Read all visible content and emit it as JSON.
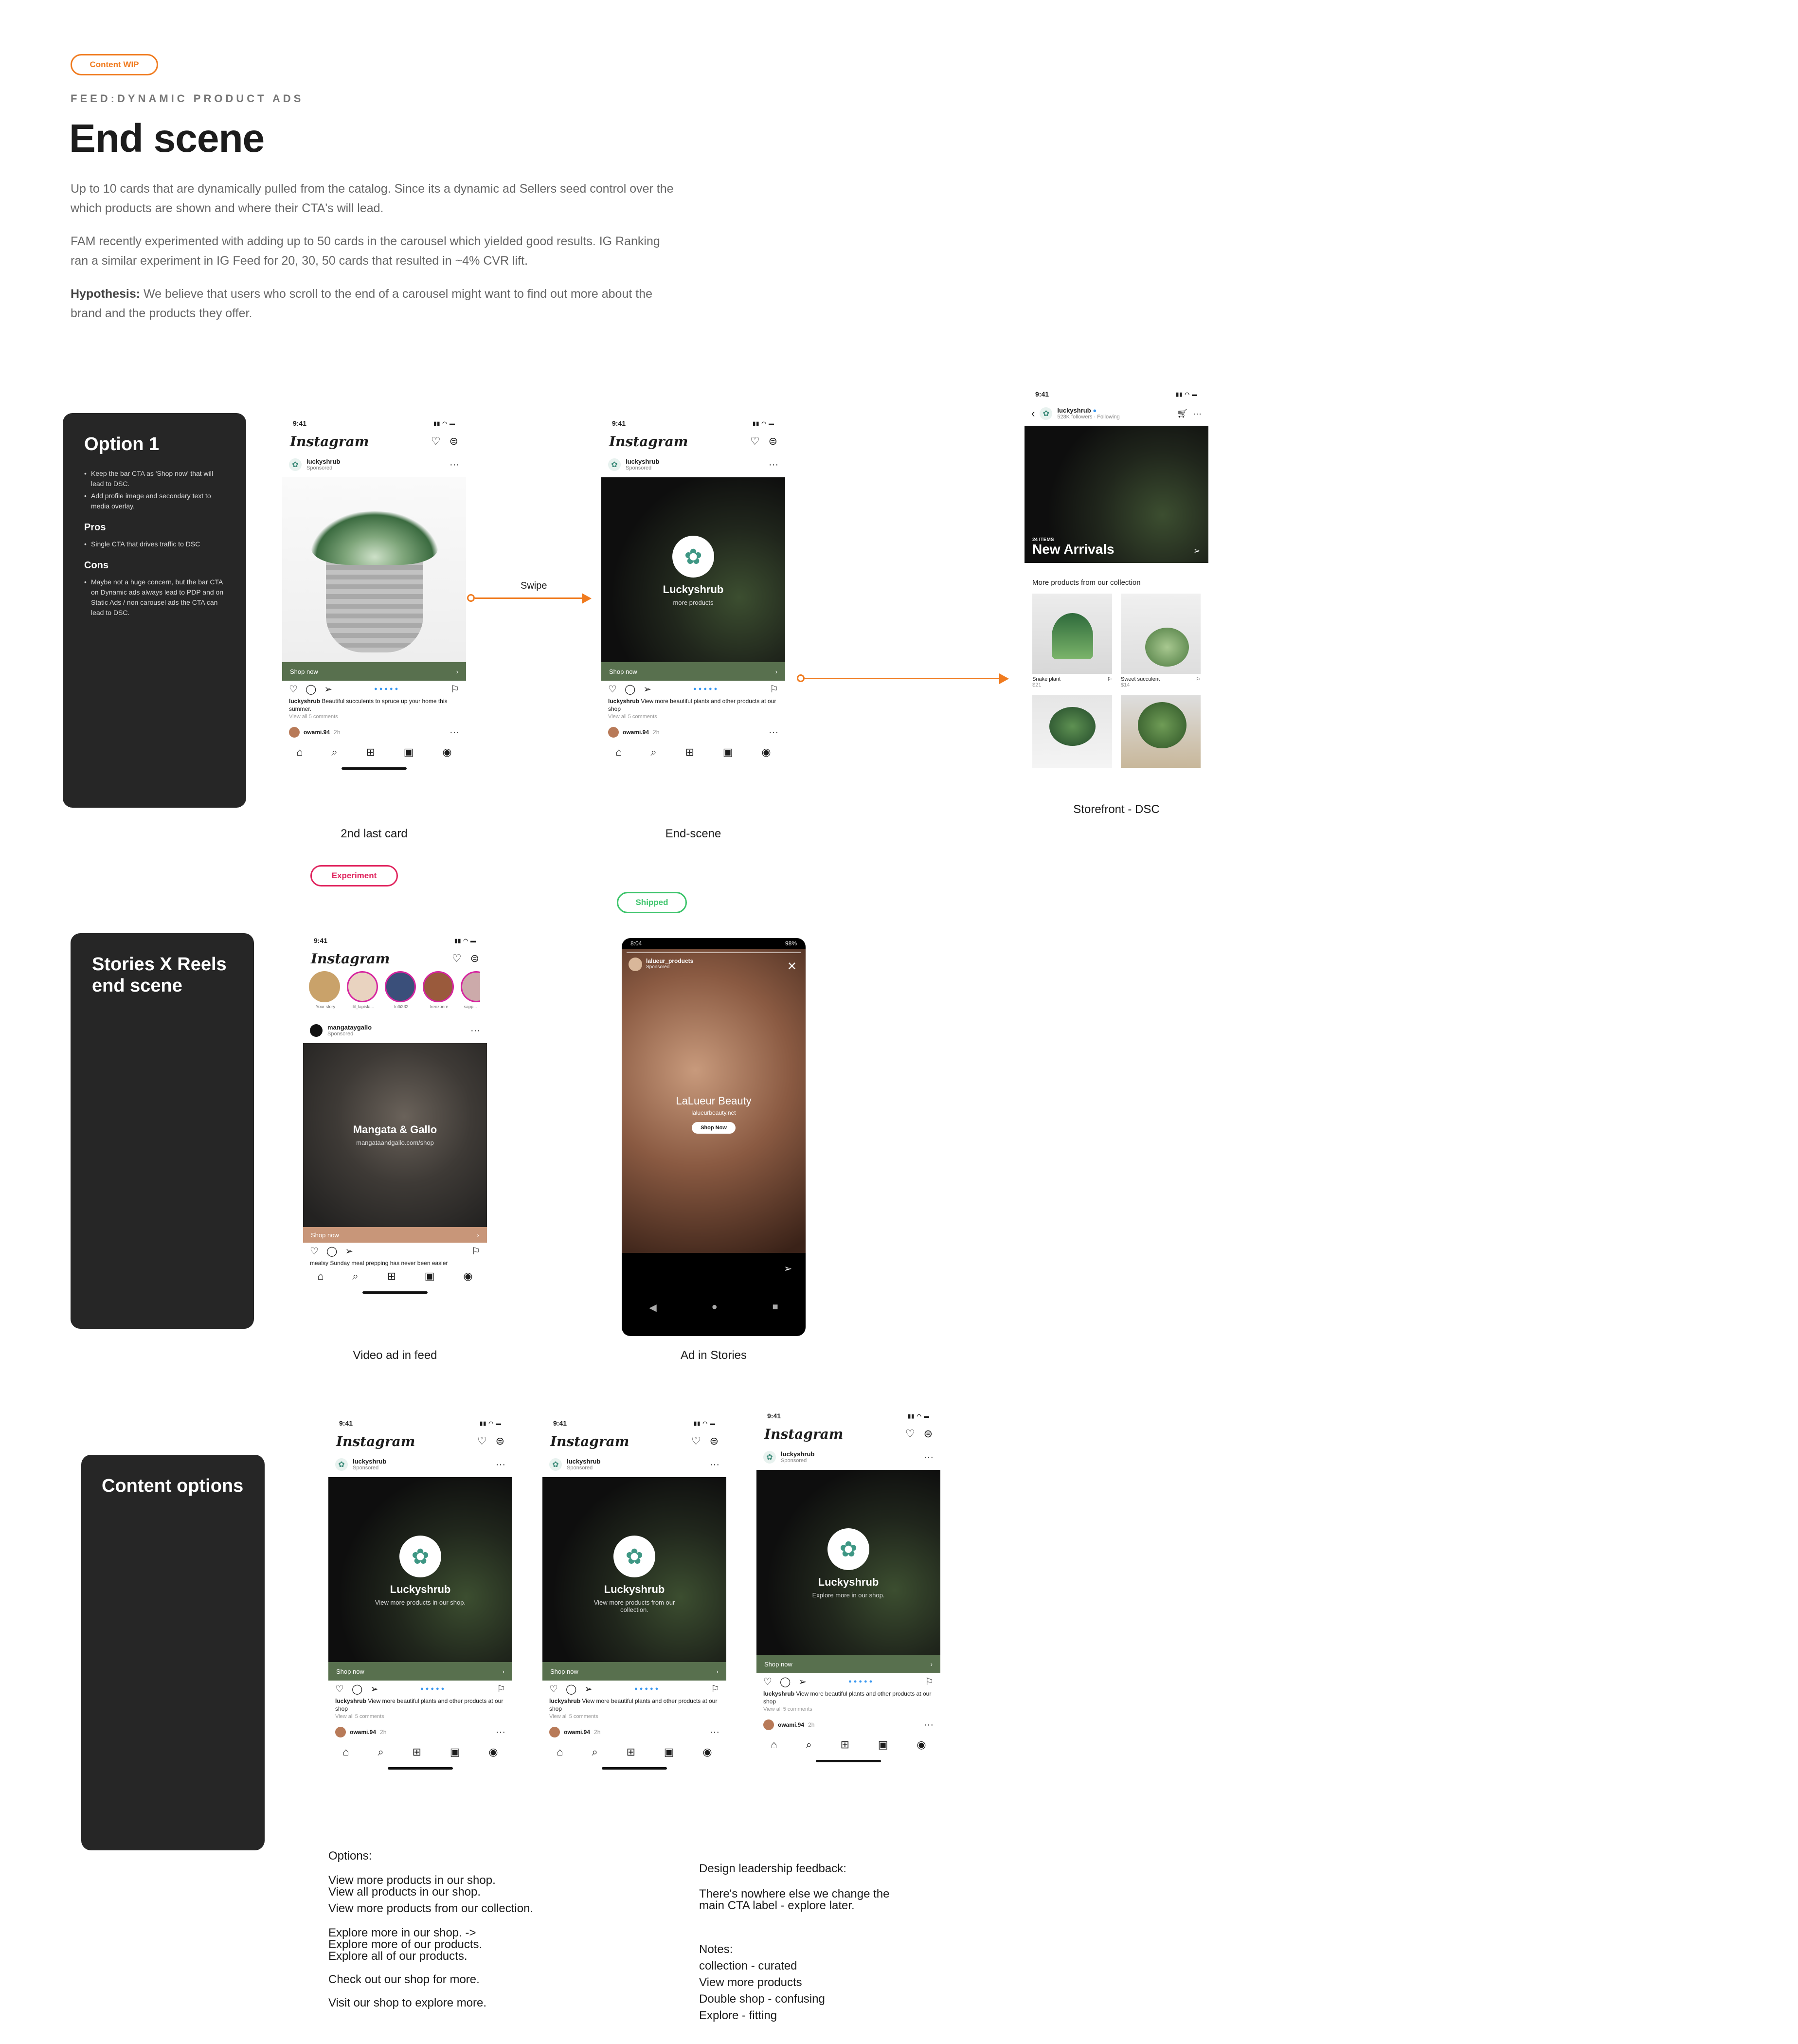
{
  "header": {
    "status_tag": "Content WIP",
    "kicker": "FEED:DYNAMIC PRODUCT ADS",
    "title": "End scene",
    "para1": "Up to 10 cards that are dynamically pulled from the catalog. Since its a dynamic ad Sellers seed control over the which products are shown and where their CTA's will lead.",
    "para2": "FAM recently experimented with adding up to 50 cards in the carousel which yielded good results. IG Ranking ran a similar experiment in IG Feed for 20, 30, 50 cards that resulted in ~4% CVR lift.",
    "hyp_label": "Hypothesis:",
    "hyp_text": " We believe that users who scroll to the end of a carousel might want to find out more about the brand and the products they offer."
  },
  "option1": {
    "title": "Option 1",
    "bullets": [
      "Keep the bar CTA as 'Shop now' that will lead to DSC.",
      "Add profile image and secondary text to media overlay."
    ],
    "pros_label": "Pros",
    "pros": [
      "Single CTA that drives traffic to DSC"
    ],
    "cons_label": "Cons",
    "cons": [
      "Maybe not a huge concern, but the bar CTA on Dynamic ads always lead to PDP and on Static Ads / non carousel ads the CTA can lead to DSC."
    ]
  },
  "stories_card": {
    "title": "Stories X Reels end scene"
  },
  "content_card": {
    "title": "Content options"
  },
  "swipe_label": "Swipe",
  "ig": {
    "time": "9:41",
    "logo": "Instagram",
    "account": "luckyshrub",
    "sponsored": "Sponsored",
    "cta": "Shop now",
    "brand": "Luckyshrub",
    "commenter": "owami.94",
    "comment_time": "2h",
    "view_comments": "View all 5 comments"
  },
  "screens": {
    "s1": {
      "caption": "2nd last card",
      "post": "Beautiful succulents to spruce up your home this summer."
    },
    "s2": {
      "caption": "End-scene",
      "sub": "more products",
      "post": "View more beautiful plants and other products at our shop"
    },
    "dsc": {
      "caption": "Storefront - DSC",
      "account": "luckyshrub",
      "followers": "528K followers · Following",
      "items": "24 ITEMS",
      "hero": "New Arrivals",
      "section": "More products from our collection",
      "products": [
        {
          "name": "Snake plant",
          "price": "$21"
        },
        {
          "name": "Sweet succulent",
          "price": "$14"
        }
      ]
    },
    "video": {
      "caption": "Video ad in feed",
      "tag": "Experiment",
      "account": "mangataygallo",
      "brand": "Mangata & Gallo",
      "url": "mangataandgallo.com/shop",
      "stories": [
        "Your story",
        "lil_lapisla...",
        "lofti232",
        "kenzoere",
        "sapp..."
      ],
      "caption_line": "mealsy Sunday meal prepping has never been easier"
    },
    "stories": {
      "caption": "Ad in Stories",
      "tag": "Shipped",
      "time": "8:04",
      "battery": "98%",
      "account": "lalueur_products",
      "sponsored": "Sponsored",
      "brand": "LaLueur Beauty",
      "url": "lalueurbeauty.net",
      "cta": "Shop Now"
    },
    "c1": {
      "sub": "View more products in our shop."
    },
    "c2": {
      "sub": "View more products from our collection."
    },
    "c3": {
      "sub": "Explore more in our shop."
    }
  },
  "options_notes": {
    "heading": "Options:",
    "lines": [
      "View more products in our shop.",
      "View all products in our shop.",
      "",
      "View more products from our collection.",
      "",
      "Explore more in our shop. ->",
      "Explore more of our products.",
      "Explore all of our products.",
      "",
      "Check out our shop for more.",
      "",
      "Visit our shop to explore more."
    ]
  },
  "feedback_notes": {
    "heading": "Design leadership feedback:",
    "text1": "There's nowhere else we change the",
    "text2": "main CTA label - explore later.",
    "notes_heading": "Notes:",
    "notes": [
      "collection - curated",
      "View more products",
      "Double shop - confusing",
      "Explore - fitting"
    ]
  },
  "colors": {
    "accent_orange": "#f07b1f",
    "experiment_pink": "#e0245e",
    "shipped_green": "#3cc46b",
    "cta_green": "#58704e",
    "card_dark": "#262626"
  }
}
